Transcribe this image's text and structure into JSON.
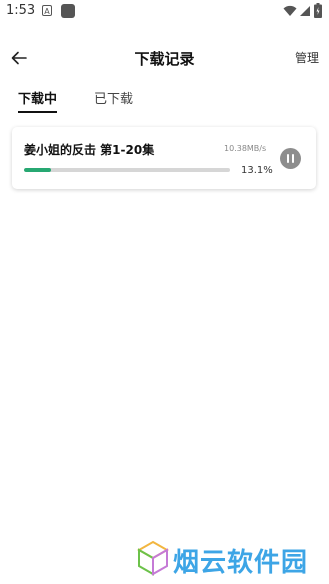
{
  "status_bar": {
    "time": "1:53",
    "notification_letter": "A"
  },
  "header": {
    "title": "下载记录",
    "manage_label": "管理"
  },
  "tabs": [
    {
      "label": "下载中",
      "active": true
    },
    {
      "label": "已下载",
      "active": false
    }
  ],
  "downloads": [
    {
      "title": "姜小姐的反击 第1-20集",
      "speed": "10.38MB/s",
      "progress_percent": 13.1,
      "progress_label": "13.1%",
      "state": "downloading"
    }
  ],
  "watermark": {
    "text": "烟云软件园"
  },
  "colors": {
    "progress_fill": "#27a872",
    "progress_track": "#d6d6d6",
    "pause_button": "#8d8d8d",
    "watermark_text": "#3da5e6"
  }
}
